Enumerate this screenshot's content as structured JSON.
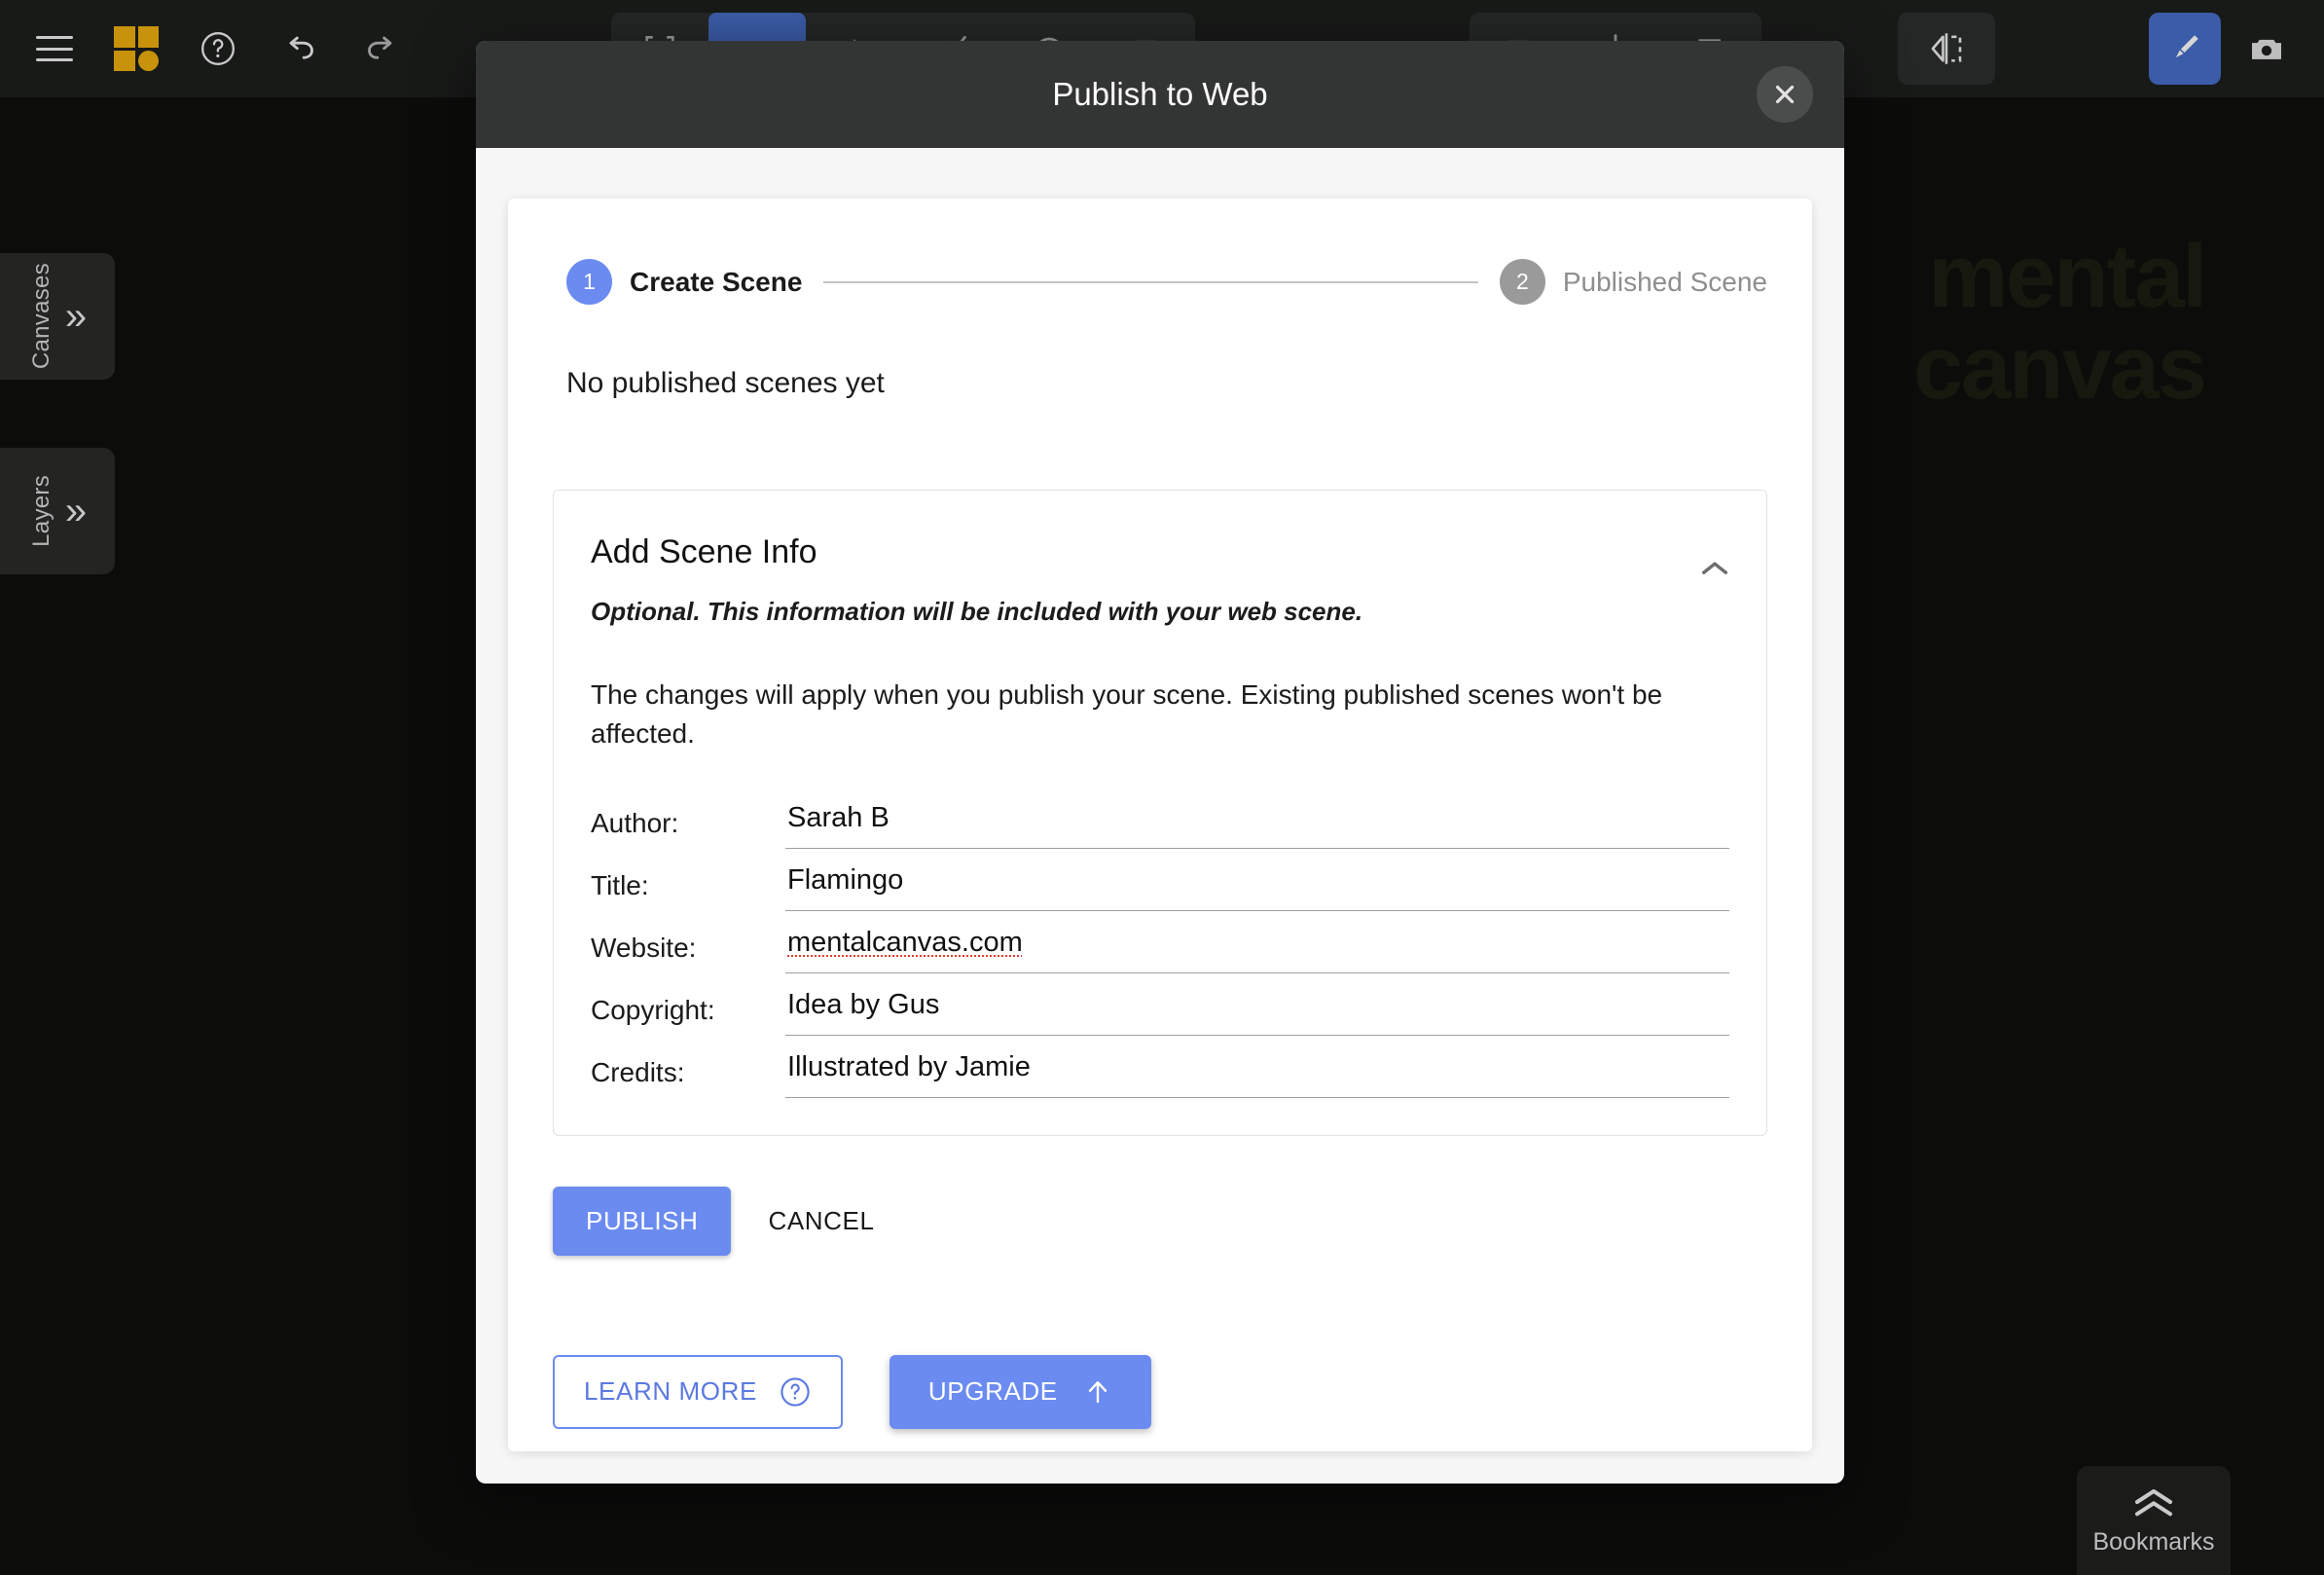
{
  "app": {
    "watermark_line1": "mental",
    "watermark_line2": "canvas",
    "accent_blue": "#6b8bf0",
    "logo_gold": "#c8930b",
    "tool_active_blue": "#3b5ca8"
  },
  "toolbar": {
    "menu_icon": "hamburger-menu-icon",
    "logo_icon": "mental-canvas-logo-icon",
    "help_icon": "help-circle-icon",
    "undo_icon": "undo-arrow-icon",
    "redo_icon": "redo-arrow-icon",
    "tools_group_a": [
      {
        "icon": "crop-select-icon",
        "active": false
      },
      {
        "icon": "ribbon-tool-icon",
        "active": true
      },
      {
        "icon": "fill-tool-icon",
        "active": false
      },
      {
        "icon": "polyline-tool-icon",
        "active": false
      },
      {
        "icon": "lasso-tool-icon",
        "active": false
      },
      {
        "icon": "rectangle-tool-icon",
        "active": false
      }
    ],
    "tools_group_b": [
      {
        "icon": "frame-tool-icon",
        "active": false
      },
      {
        "icon": "distribute-tool-icon",
        "active": false
      },
      {
        "icon": "duplicate-tool-icon",
        "active": false
      }
    ],
    "tools_group_c": [
      {
        "icon": "mirror-tool-icon",
        "active": false
      }
    ],
    "right_tools": [
      {
        "icon": "paintbrush-icon",
        "active": true
      },
      {
        "icon": "camera-icon",
        "active": false
      }
    ]
  },
  "side_panels": [
    {
      "label": "Canvases",
      "chevron": "»",
      "name": "canvases"
    },
    {
      "label": "Layers",
      "chevron": "»",
      "name": "layers"
    }
  ],
  "bookmarks": {
    "label": "Bookmarks",
    "chevron_icon": "double-chevron-up-icon"
  },
  "dialog": {
    "title": "Publish to Web",
    "close_icon": "close-icon",
    "stepper": [
      {
        "number": "1",
        "label": "Create Scene",
        "state": "active"
      },
      {
        "number": "2",
        "label": "Published Scene",
        "state": "inactive"
      }
    ],
    "empty_state": "No published scenes yet",
    "scene_info": {
      "heading": "Add Scene Info",
      "collapse_icon": "chevron-up-icon",
      "subtitle": "Optional. This information will be included with your web scene.",
      "description": "The changes will apply when you publish your scene. Existing published scenes won't be affected.",
      "fields": [
        {
          "name": "author",
          "label": "Author:",
          "value": "Sarah B",
          "misspelled": false
        },
        {
          "name": "title",
          "label": "Title:",
          "value": "Flamingo",
          "misspelled": false
        },
        {
          "name": "website",
          "label": "Website:",
          "value": "mentalcanvas.com",
          "misspelled": true
        },
        {
          "name": "copyright",
          "label": "Copyright:",
          "value": "Idea by Gus",
          "misspelled": false
        },
        {
          "name": "credits",
          "label": "Credits:",
          "value": "Illustrated by Jamie",
          "misspelled": false
        }
      ]
    },
    "publish_label": "PUBLISH",
    "cancel_label": "CANCEL",
    "learn_more_label": "LEARN MORE",
    "learn_more_icon": "help-circle-icon",
    "upgrade_label": "UPGRADE",
    "upgrade_icon": "arrow-up-icon"
  }
}
